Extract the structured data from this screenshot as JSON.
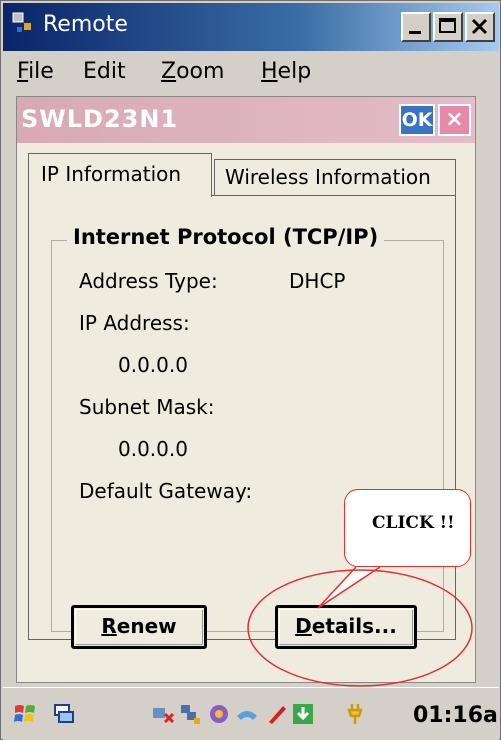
{
  "window": {
    "title": "Remote",
    "controls": {
      "minimize_icon": "minimize-icon",
      "maximize_icon": "maximize-icon",
      "close_icon": "close-icon"
    }
  },
  "menubar": {
    "items": [
      {
        "label": "File",
        "mnemonic": "F",
        "rest": "ile"
      },
      {
        "label": "Edit",
        "mnemonic": "",
        "rest": "Edit"
      },
      {
        "label": "Zoom",
        "mnemonic": "Z",
        "rest": "oom"
      },
      {
        "label": "Help",
        "mnemonic": "H",
        "rest": "elp"
      }
    ]
  },
  "dialog": {
    "title": "SWLD23N1",
    "ok_label": "OK",
    "close_label": "×",
    "tabs": [
      {
        "label": "IP Information",
        "active": true
      },
      {
        "label": "Wireless Information",
        "active": false
      }
    ],
    "group_title": "Internet Protocol (TCP/IP)",
    "fields": {
      "address_type_label": "Address Type:",
      "address_type_value": "DHCP",
      "ip_address_label": "IP Address:",
      "ip_address_value": "0.0.0.0",
      "subnet_mask_label": "Subnet Mask:",
      "subnet_mask_value": "0.0.0.0",
      "default_gateway_label": "Default Gateway:"
    },
    "buttons": {
      "renew": {
        "mnemonic": "R",
        "rest": "enew"
      },
      "details": {
        "mnemonic": "D",
        "rest": "etails..."
      }
    }
  },
  "annotation": {
    "callout_text": "CLICK !!",
    "accent_color": "#e03030"
  },
  "taskbar": {
    "clock": "01:16a",
    "icons": [
      "start-icon",
      "switch-icon",
      "network-icon",
      "bluetooth-icon",
      "sync-icon",
      "edit-icon",
      "download-icon",
      "power-icon"
    ]
  }
}
